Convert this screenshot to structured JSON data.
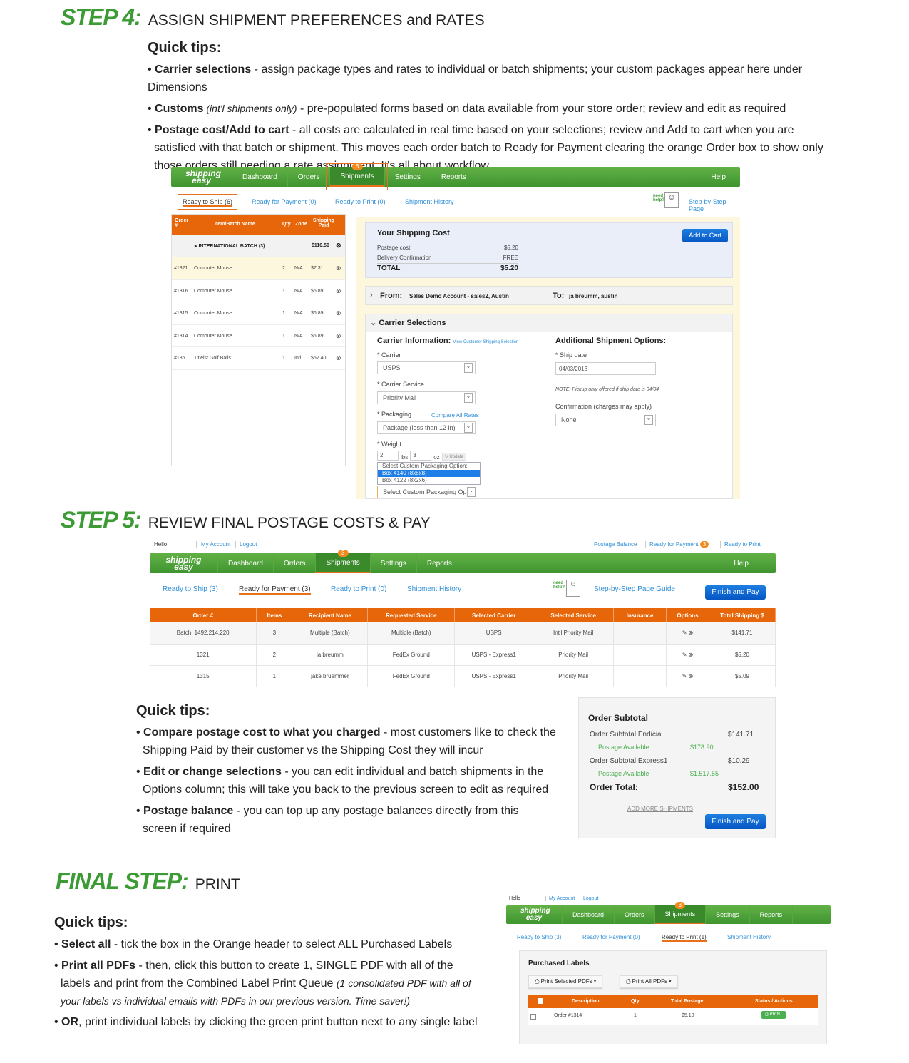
{
  "step4": {
    "step": "STEP 4:",
    "title": "ASSIGN SHIPMENT PREFERENCES and RATES",
    "quick_tips": "Quick tips:",
    "tips": [
      {
        "bold": "Carrier selections",
        "text": " - assign package types and rates to individual or batch shipments; your custom packages appear here under Dimensions"
      },
      {
        "bold": "Customs",
        "italic": " (int'l shipments only)",
        "text": " - pre-populated forms based on data available from your store order; review and edit as required"
      },
      {
        "bold": "Postage cost/Add to cart",
        "text": " - all costs are calculated in real time based on your selections; review and Add to cart when you are satisfied with that batch or shipment. This moves each order batch to Ready for Payment clearing the orange Order box to show only those orders still needing a rate assignment. It's all about workflow"
      }
    ],
    "app": {
      "logo": "shipping easy",
      "nav": [
        "Dashboard",
        "Orders",
        "Shipments",
        "Settings",
        "Reports"
      ],
      "badge": "6",
      "help": "Help",
      "subtabs": [
        "Ready to Ship (6)",
        "Ready for Payment (0)",
        "Ready to Print (0)",
        "Shipment History"
      ],
      "need_help": "need help?",
      "guide": "Step-by-Step Page",
      "table_headers": [
        "Order #",
        "Item/Batch Name",
        "Qty",
        "Zone",
        "Shipping Paid"
      ],
      "batch": {
        "name": "INTERNATIONAL BATCH (3)",
        "paid": "$110.50"
      },
      "rows": [
        [
          "#1321",
          "Computer Mouse",
          "2",
          "N/A",
          "$7.31"
        ],
        [
          "#1316",
          "Computer Mouse",
          "1",
          "N/A",
          "$6.89"
        ],
        [
          "#1315",
          "Computer Mouse",
          "1",
          "N/A",
          "$6.89"
        ],
        [
          "#1314",
          "Computer Mouse",
          "1",
          "N/A",
          "$6.89"
        ],
        [
          "#186",
          "Titleist Golf Balls",
          "1",
          "Intl",
          "$52.40"
        ]
      ],
      "cost": {
        "title": "Your Shipping Cost",
        "add": "Add to Cart",
        "lines": [
          [
            "Postage cost:",
            "$5.20"
          ],
          [
            "Delivery Confirmation",
            "FREE"
          ]
        ],
        "total": [
          "TOTAL",
          "$5.20"
        ]
      },
      "from_label": "From:",
      "from": "Sales Demo Account - sales2, Austin",
      "to_label": "To:",
      "to": "ja breumm, austin",
      "carrier_sel": "Carrier Selections",
      "carrier_info": "Carrier Information:",
      "view_sel": "View Customer Shipping Selection",
      "carrier_label": "* Carrier",
      "carrier": "USPS",
      "service_label": "* Carrier Service",
      "service": "Priority Mail",
      "packaging_label": "* Packaging",
      "compare": "Compare All Rates",
      "packaging": "Package (less than 12 in)",
      "weight_label": "* Weight",
      "lbs": "2",
      "lbs_unit": "lbs",
      "oz": "3",
      "oz_unit": "oz",
      "update": "Update",
      "custom_options": [
        "Select Custom Packaging Option:",
        "Box 4140 (8x8x8)",
        "Box 4122 (8x2x6)"
      ],
      "custom_sel": "Select Custom Packaging Op",
      "additional": "Additional Shipment Options:",
      "ship_date_label": "* Ship date",
      "ship_date": "04/03/2013",
      "note": "NOTE: Pickup only offered if ship date is 04/04",
      "confirm_label": "Confirmation (charges may apply)",
      "confirm": "None"
    }
  },
  "step5": {
    "step": "STEP 5:",
    "title": "REVIEW FINAL POSTAGE COSTS & PAY",
    "app": {
      "hello": "Hello",
      "my_account": "My Account",
      "logout": "Logout",
      "postage_balance": "Postage Balance",
      "ready_payment": "Ready for Payment",
      "ready_badge": "3",
      "ready_print": "Ready to Print",
      "nav": [
        "Dashboard",
        "Orders",
        "Shipments",
        "Settings",
        "Reports"
      ],
      "badge": "3",
      "help": "Help",
      "subtabs": [
        "Ready to Ship (3)",
        "Ready for Payment (3)",
        "Ready to Print (0)",
        "Shipment History"
      ],
      "need_help": "need help?",
      "guide": "Step-by-Step Page Guide",
      "finish": "Finish and Pay",
      "headers": [
        "Order #",
        "Items",
        "Recipient Name",
        "Requested Service",
        "Selected Carrier",
        "Selected Service",
        "Insurance",
        "Options",
        "Total Shipping $"
      ],
      "rows": [
        [
          "Batch: 1492,214,220",
          "3",
          "Multiple (Batch)",
          "Multiple (Batch)",
          "USPS",
          "Int'l Priority Mail",
          "",
          "",
          "$141.71"
        ],
        [
          "1321",
          "2",
          "ja breumm",
          "FedEx Ground",
          "USPS - Express1",
          "Priority Mail",
          "",
          "",
          "$5.20"
        ],
        [
          "1315",
          "1",
          "jake bruemmer",
          "FedEx Ground",
          "USPS - Express1",
          "Priority Mail",
          "",
          "",
          "$5.09"
        ]
      ],
      "subtotal": {
        "title": "Order Subtotal",
        "endicia": [
          "Order Subtotal Endicia",
          "$141.71"
        ],
        "avail1": [
          "Postage Available",
          "$178.90"
        ],
        "express": [
          "Order Subtotal Express1",
          "$10.29"
        ],
        "avail2": [
          "Postage Available",
          "$1,517.55"
        ],
        "total": [
          "Order Total:",
          "$152.00"
        ],
        "add_more": "ADD MORE SHIPMENTS",
        "finish": "Finish and Pay"
      }
    },
    "quick_tips": "Quick tips:",
    "tips": [
      {
        "bold": "Compare postage cost to what you charged",
        "text": " - most customers like to check the Shipping Paid by their customer vs the Shipping Cost they will incur"
      },
      {
        "bold": "Edit or change selections",
        "text": " - you can edit individual and batch shipments in the Options column; this will take you back to the previous screen to edit as required"
      },
      {
        "bold": "Postage balance",
        "text": " - you can top up any postage balances directly from this screen if required"
      }
    ]
  },
  "final": {
    "step": "FINAL STEP:",
    "title": "PRINT",
    "quick_tips": "Quick tips:",
    "tips": [
      {
        "bold": "Select all",
        "text": " - tick the box in the Orange header to select ALL Purchased Labels"
      },
      {
        "bold": "Print all PDFs",
        "text": " - then, click this button to create 1, SINGLE PDF with all of the labels and print from the Combined Label Print Queue ",
        "italic": "(1 consolidated PDF with all of your labels vs individual emails with PDFs in our previous version. Time saver!)"
      },
      {
        "bold": "OR",
        "text": ", print individual labels by clicking the green print button next to any single label"
      }
    ],
    "app": {
      "hello": "Hello",
      "my_account": "My Account",
      "logout": "Logout",
      "nav": [
        "Dashboard",
        "Orders",
        "Shipments",
        "Settings",
        "Reports"
      ],
      "badge": "3",
      "subtabs": [
        "Ready to Ship (3)",
        "Ready for Payment (0)",
        "Ready to Print (1)",
        "Shipment History"
      ],
      "purchased": "Purchased Labels",
      "print_selected": "Print Selected PDFs",
      "print_all": "Print All PDFs",
      "headers": [
        "Description",
        "Qty",
        "Total Postage",
        "Status / Actions"
      ],
      "row": [
        "Order #1314",
        "1",
        "$5.10"
      ],
      "print": "PRINT"
    }
  },
  "colors": {
    "green": "#3d9b35",
    "orange": "#e8660a",
    "blue": "#0a5fc8",
    "link": "#2f8fd8"
  }
}
